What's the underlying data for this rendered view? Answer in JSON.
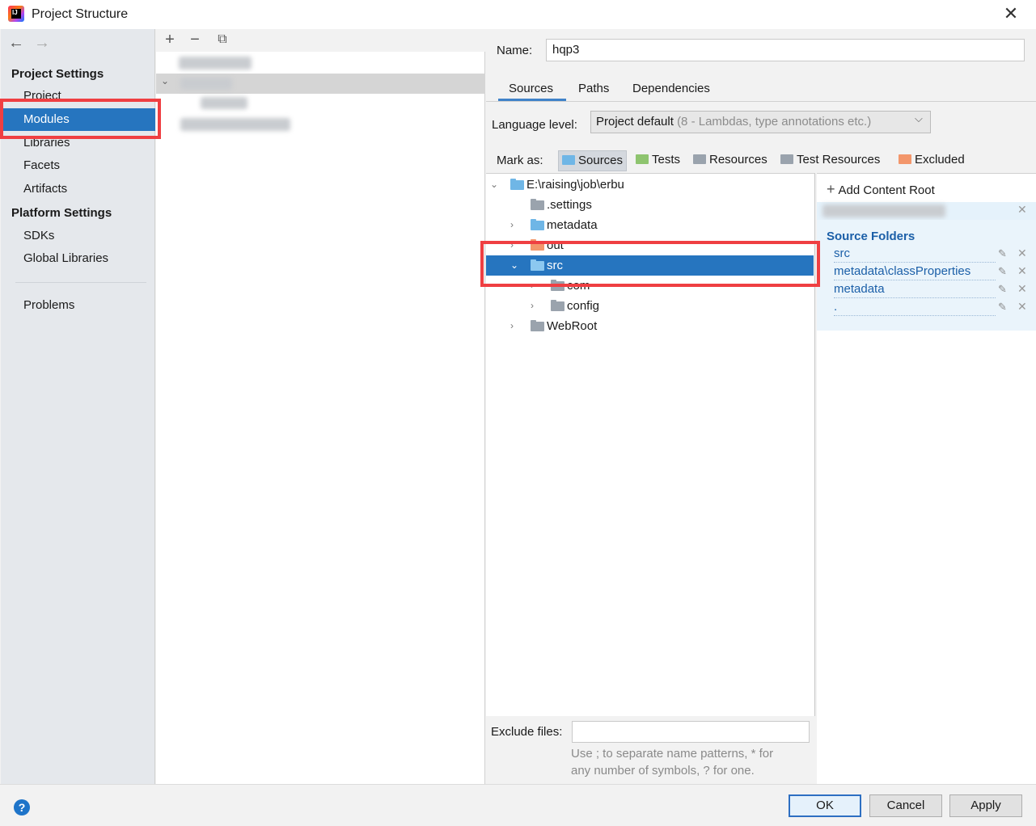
{
  "window": {
    "title": "Project Structure",
    "close": "✕"
  },
  "nav": {
    "back": "←",
    "forward": "→",
    "project_settings_header": "Project Settings",
    "project_settings": [
      "Project",
      "Modules",
      "Libraries",
      "Facets",
      "Artifacts"
    ],
    "platform_settings_header": "Platform Settings",
    "platform_settings": [
      "SDKs",
      "Global Libraries"
    ],
    "problems": "Problems",
    "selected": "Modules"
  },
  "module_toolbar": {
    "add": "+",
    "remove": "−",
    "copy": "⧉"
  },
  "module": {
    "name_label": "Name:",
    "name_value": "hqp3",
    "tabs": [
      "Sources",
      "Paths",
      "Dependencies"
    ],
    "active_tab": "Sources",
    "language_level_label": "Language level:",
    "language_level_value": "Project default",
    "language_level_hint": "(8 - Lambdas, type annotations etc.)",
    "mark_as_label": "Mark as:",
    "mark_as": [
      {
        "label": "Sources",
        "color": "#6fb6e6",
        "active": true
      },
      {
        "label": "Tests",
        "color": "#8ec46f",
        "active": false
      },
      {
        "label": "Resources",
        "color": "#9aa3ad",
        "active": false
      },
      {
        "label": "Test Resources",
        "color": "#9aa3ad",
        "active": false
      },
      {
        "label": "Excluded",
        "color": "#f3966b",
        "active": false
      }
    ]
  },
  "content_tree": [
    {
      "label": "E:\\raising\\job\\erbu",
      "chevron": "⌄",
      "color": "#6fb6e6"
    },
    {
      "label": ".settings",
      "chevron": "",
      "color": "#9aa3ad"
    },
    {
      "label": "metadata",
      "chevron": "›",
      "color": "#6fb6e6"
    },
    {
      "label": "out",
      "chevron": "›",
      "color": "#f3966b"
    },
    {
      "label": "src",
      "chevron": "⌄",
      "color": "#6fb6e6",
      "selected": true
    },
    {
      "label": "com",
      "chevron": "›",
      "color": "#9aa3ad"
    },
    {
      "label": "config",
      "chevron": "›",
      "color": "#9aa3ad"
    },
    {
      "label": "WebRoot",
      "chevron": "›",
      "color": "#9aa3ad"
    }
  ],
  "roots": {
    "add_content_root": "Add Content Root",
    "source_folders_title": "Source Folders",
    "source_folders": [
      "src",
      "metadata\\classProperties",
      "metadata",
      "."
    ],
    "edit_icon": "✎",
    "remove_icon": "✕"
  },
  "exclude": {
    "label": "Exclude files:",
    "value": "",
    "hint_line1": "Use ; to separate name patterns, * for",
    "hint_line2": "any number of symbols, ? for one."
  },
  "footer": {
    "help": "?",
    "ok": "OK",
    "cancel": "Cancel",
    "apply": "Apply"
  },
  "colors": {
    "selection": "#2675bf",
    "highlight": "#ef3f42",
    "link": "#1b5fa8"
  }
}
